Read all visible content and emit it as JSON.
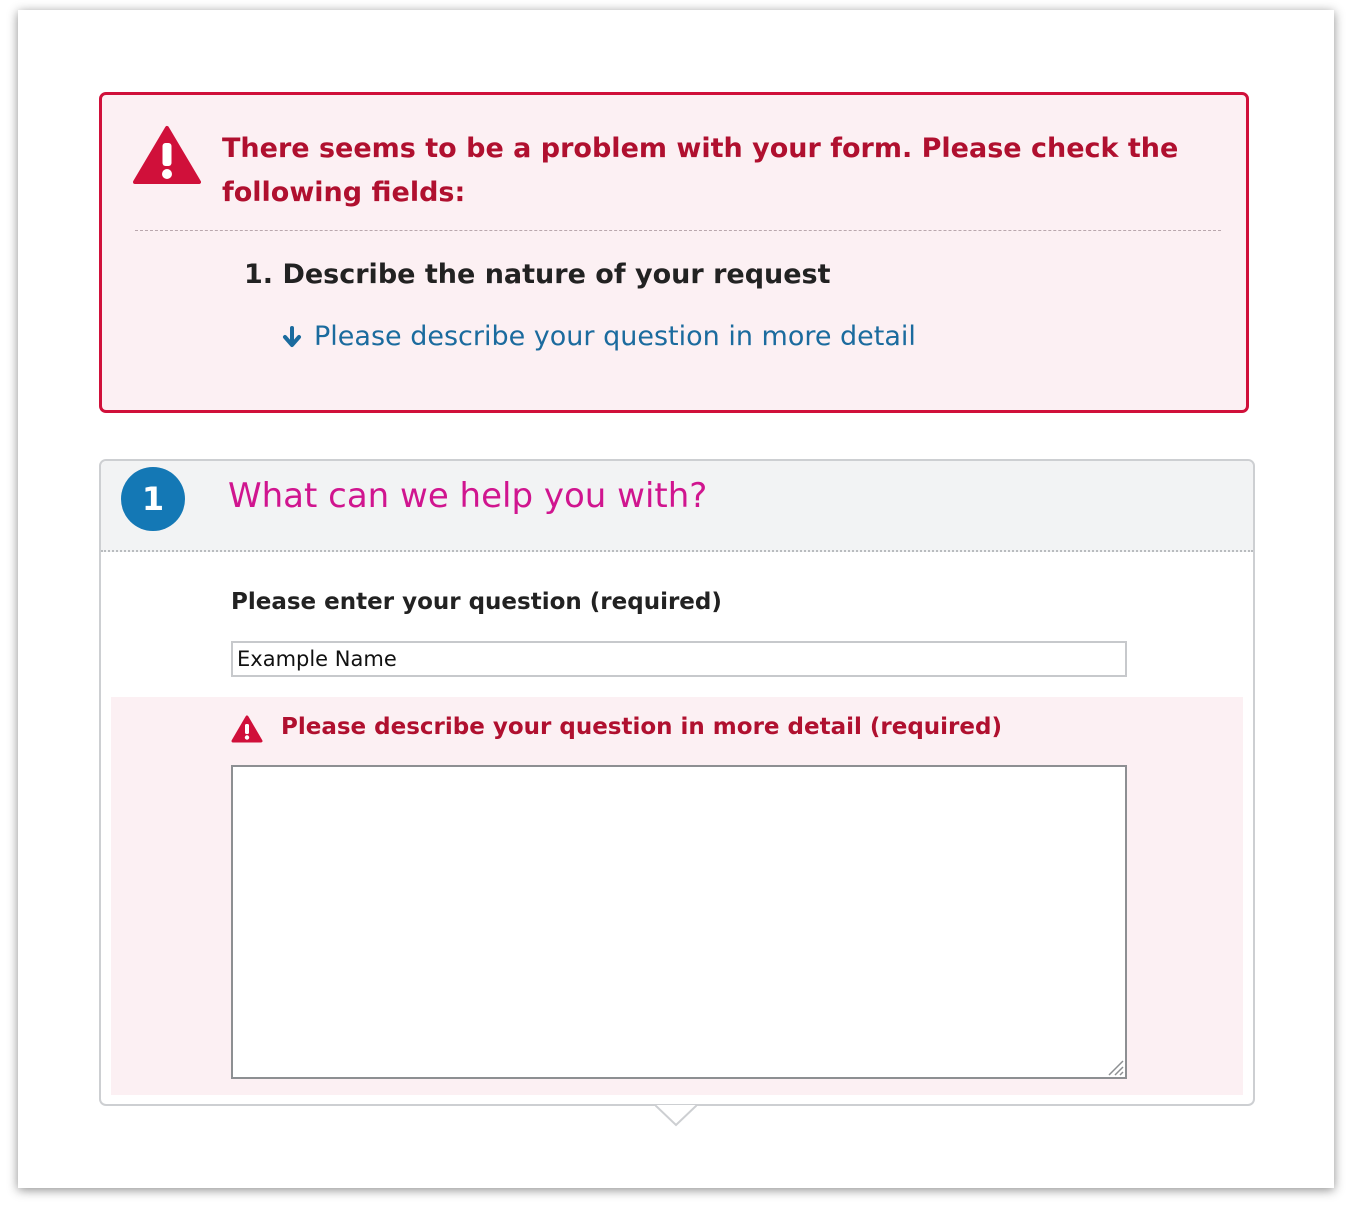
{
  "error_summary": {
    "heading": "There seems to be a problem with your form. Please check the following fields:",
    "item_title": "1. Describe the nature of your request",
    "item_link": "Please describe your question in more detail",
    "icon": "warning-triangle-icon",
    "link_icon": "arrow-down-icon"
  },
  "section": {
    "step_number": "1",
    "title": "What can we help you with?",
    "question_label": "Please enter your question (required)",
    "question_value": "Example Name",
    "detail_label": "Please describe your question in more detail (required)",
    "detail_value": "",
    "detail_icon": "warning-triangle-icon"
  },
  "colors": {
    "error_red": "#b0102f",
    "error_border": "#d0103a",
    "error_background": "#fcf0f3",
    "link_blue": "#1b6b9e",
    "title_magenta": "#d0158f",
    "badge_blue": "#1478b5",
    "header_gray": "#f2f3f4"
  }
}
